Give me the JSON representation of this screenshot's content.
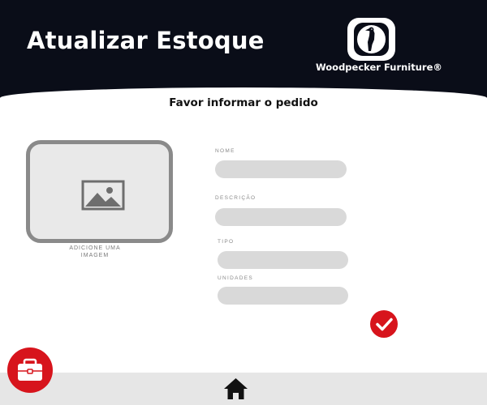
{
  "header": {
    "title": "Atualizar Estoque",
    "brand_name": "Woodpecker Furniture®",
    "logo_icon": "woodpecker-logo-icon"
  },
  "form": {
    "subtitle": "Favor informar o pedido",
    "image_upload": {
      "caption": "ADICIONE UMA IMAGEM",
      "icon": "image-placeholder-icon"
    },
    "fields": {
      "nome": {
        "label": "NOME",
        "value": "",
        "placeholder": ""
      },
      "descricao": {
        "label": "DESCRIÇÃO",
        "value": "",
        "placeholder": ""
      },
      "tipo": {
        "label": "TIPO",
        "value": "",
        "placeholder": ""
      },
      "unidades": {
        "label": "UNIDADES",
        "value": "",
        "placeholder": ""
      }
    },
    "confirm_icon": "checkmark-icon"
  },
  "nav": {
    "home_icon": "home-icon",
    "briefcase_icon": "briefcase-icon"
  },
  "colors": {
    "header_bg": "#0a0d18",
    "accent_red": "#d7141c",
    "input_bg": "#d9d9d9",
    "bottom_bar": "#e6e6e6"
  }
}
